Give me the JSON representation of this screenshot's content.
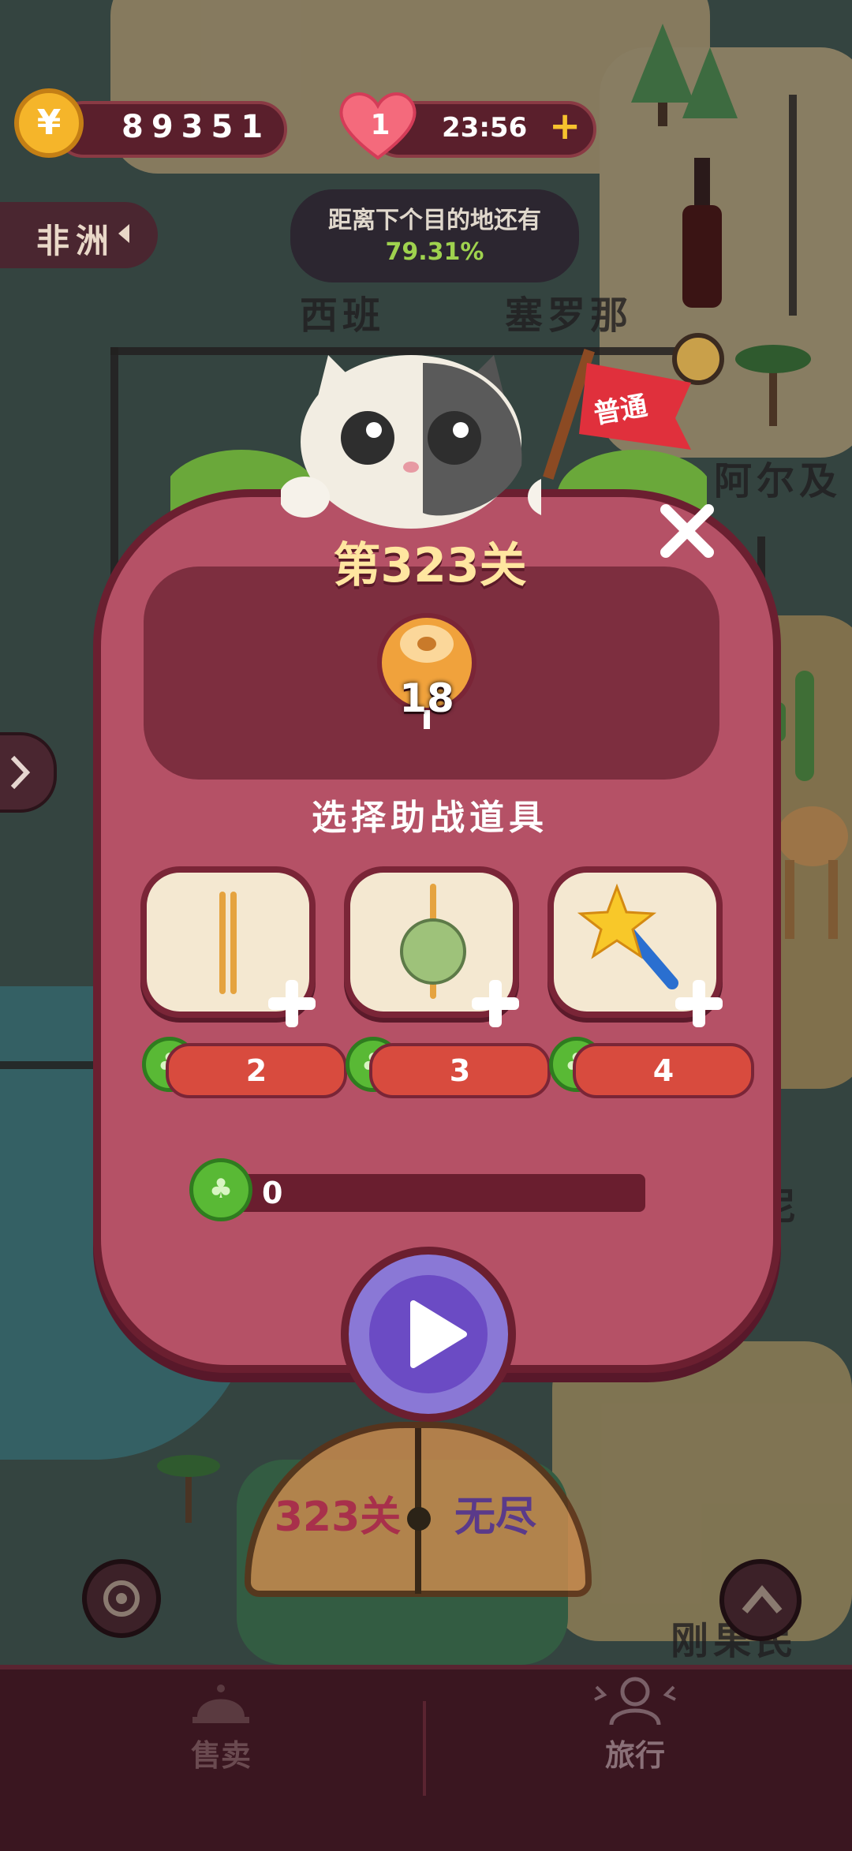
{
  "hud": {
    "coins": "89351",
    "coin_symbol": "¥",
    "lives": "1",
    "timer": "23:56",
    "add_symbol": "+"
  },
  "map": {
    "region_button": "非洲",
    "labels": [
      "西班",
      "塞罗那",
      "阿尔及",
      "尼",
      "刚果民"
    ],
    "progress_caption": "距离下个目的地还有",
    "progress_percent": "79.31%"
  },
  "flag": {
    "label": "普通"
  },
  "level": {
    "title": "第323关",
    "target_count": "18"
  },
  "boosters": {
    "title": "选择助战道具",
    "items": [
      {
        "icon": "chopstick-icon",
        "cost": "2"
      },
      {
        "icon": "meatball-skewer-icon",
        "cost": "3"
      },
      {
        "icon": "magic-wand-icon",
        "cost": "4"
      }
    ],
    "total": "0"
  },
  "mode_selector": {
    "left": "323关",
    "right": "无尽"
  },
  "tabbar": {
    "sell": "售卖",
    "travel": "旅行"
  },
  "colors": {
    "modal": "#b55166",
    "accent_green": "#59b935",
    "play_purple": "#6b4bc4"
  }
}
